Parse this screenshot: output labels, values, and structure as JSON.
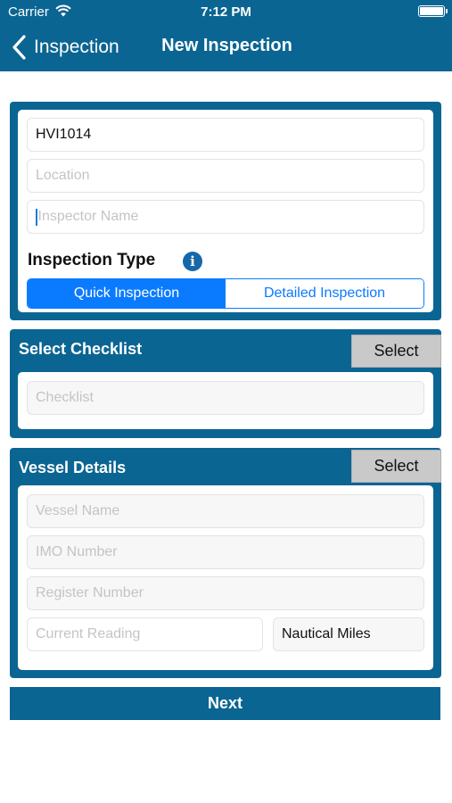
{
  "status_bar": {
    "carrier": "Carrier",
    "time": "7:12 PM",
    "icons": [
      "wifi-icon",
      "battery-icon"
    ]
  },
  "nav": {
    "back_label": "Inspection",
    "back_icon": "chevron-left-icon",
    "title": "New Inspection"
  },
  "inspection": {
    "code_value": "HVI1014",
    "location_placeholder": "Location",
    "inspector_placeholder": "Inspector Name",
    "type_label": "Inspection Type",
    "info_icon": "info-icon",
    "info_glyph": "i",
    "segments": [
      {
        "label": "Quick Inspection",
        "selected": true
      },
      {
        "label": "Detailed Inspection",
        "selected": false
      }
    ]
  },
  "checklist": {
    "title": "Select Checklist",
    "select_label": "Select",
    "placeholder": "Checklist"
  },
  "vessel": {
    "title": "Vessel Details",
    "select_label": "Select",
    "vessel_name_placeholder": "Vessel Name",
    "imo_placeholder": "IMO Number",
    "register_placeholder": "Register Number",
    "reading_placeholder": "Current Reading",
    "unit_value": "Nautical Miles"
  },
  "actions": {
    "next_label": "Next"
  },
  "colors": {
    "header": "#0b6593",
    "segment_accent": "#0a7bff",
    "select_button": "#c9c9c9",
    "info_icon": "#1668a8"
  }
}
